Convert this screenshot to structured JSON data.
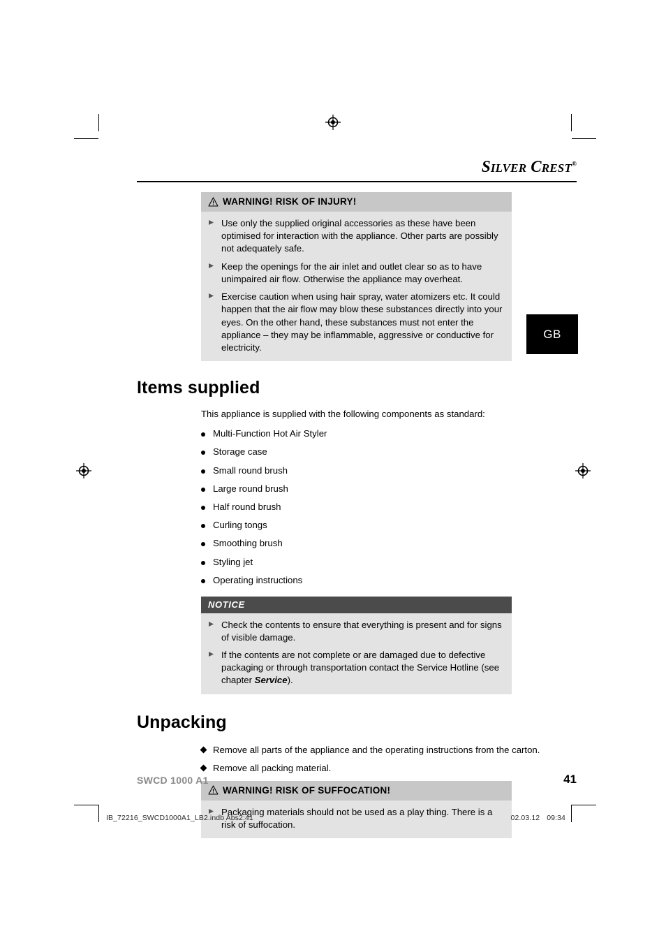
{
  "brand": {
    "name_part1": "S",
    "name_part2": "ILVER",
    "name_part3": "C",
    "name_part4": "REST",
    "registered": "®"
  },
  "country_tab": {
    "label": "GB"
  },
  "warning_injury": {
    "icon": "warning-triangle-icon",
    "title": "WARNING! RISK OF INJURY!",
    "bullets": [
      "Use only the supplied original accessories as these have been optimised for interaction with the appliance. Other parts are possibly not adequately safe.",
      "Keep the openings for the air inlet and outlet clear so as to have unimpaired air flow. Otherwise the appliance may overheat.",
      "Exercise caution when using hair spray, water atomizers etc. It could happen that the air flow may blow these substances directly into your eyes. On the other hand, these substances must not enter the appliance – they may be inflammable, aggressive or conductive for electricity."
    ]
  },
  "items_supplied": {
    "heading": "Items supplied",
    "intro": "This appliance is supplied with the following components as standard:",
    "items": [
      "Multi-Function Hot Air Styler",
      "Storage case",
      "Small round brush",
      "Large round brush",
      "Half round brush",
      "Curling tongs",
      "Smoothing brush",
      "Styling jet",
      "Operating instructions"
    ]
  },
  "notice": {
    "title": "NOTICE",
    "bullet1": "Check the contents to ensure that everything is present and for signs of visible damage.",
    "bullet2_pre": "If the contents are not complete or are damaged due to defective packaging or through transportation contact the Service Hotline (see chapter ",
    "bullet2_em": "Service",
    "bullet2_post": ")."
  },
  "unpacking": {
    "heading": "Unpacking",
    "steps": [
      "Remove all parts of the appliance and the operating instructions from the carton.",
      "Remove all packing material."
    ]
  },
  "warning_suffocation": {
    "icon": "warning-triangle-icon",
    "title": "WARNING! RISK OF SUFFOCATION!",
    "bullets": [
      "Packaging materials should not be used as a play thing. There is a risk of suffocation."
    ]
  },
  "footer": {
    "model": "SWCD 1000 A1",
    "page_number": "41",
    "print_file": "IB_72216_SWCD1000A1_LB2.indb   Abs2:41",
    "print_date": "02.03.12",
    "print_time": "09:34"
  }
}
